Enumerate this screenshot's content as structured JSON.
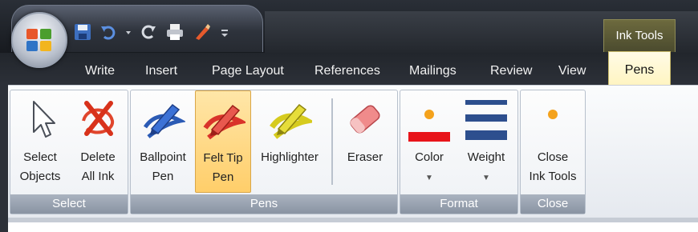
{
  "context_tab": {
    "label": "Ink Tools"
  },
  "tabs": [
    {
      "label": "Write"
    },
    {
      "label": "Insert"
    },
    {
      "label": "Page Layout"
    },
    {
      "label": "References"
    },
    {
      "label": "Mailings"
    },
    {
      "label": "Review"
    },
    {
      "label": "View"
    },
    {
      "label": "Pens"
    }
  ],
  "groups": {
    "select": {
      "label": "Select",
      "buttons": [
        {
          "label": "Select\nObjects",
          "icon": "select-arrow-icon"
        },
        {
          "label": "Delete\nAll Ink",
          "icon": "delete-ink-icon"
        }
      ]
    },
    "pens": {
      "label": "Pens",
      "buttons": [
        {
          "label": "Ballpoint\nPen",
          "icon": "ballpoint-pen-icon"
        },
        {
          "label": "Felt Tip\nPen",
          "icon": "felt-tip-pen-icon",
          "selected": true
        },
        {
          "label": "Highlighter",
          "icon": "highlighter-icon"
        },
        {
          "label": "Eraser",
          "icon": "eraser-icon"
        }
      ]
    },
    "format": {
      "label": "Format",
      "buttons": [
        {
          "label": "Color",
          "icon": "color-icon",
          "value": "#e8141a"
        },
        {
          "label": "Weight",
          "icon": "weight-icon"
        }
      ]
    },
    "close": {
      "label": "Close",
      "buttons": [
        {
          "label": "Close\nInk Tools",
          "icon": "close-ink-tools-icon"
        }
      ]
    }
  },
  "colors": {
    "accent_orange": "#f4a21c",
    "color_swatch": "#e8141a",
    "weight_lines": "#2d4f8e"
  }
}
